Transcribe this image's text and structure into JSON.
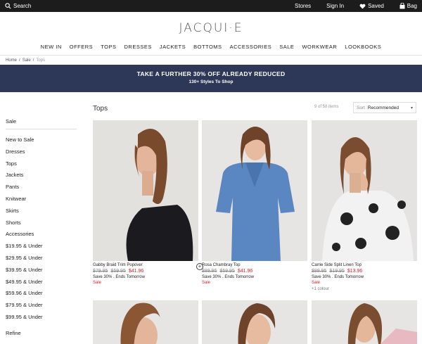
{
  "topbar": {
    "search": "Search",
    "stores": "Stores",
    "sign_in": "Sign In",
    "saved": "Saved",
    "bag": "Bag"
  },
  "logo": "JACQUI·E",
  "nav": [
    "NEW IN",
    "OFFERS",
    "TOPS",
    "DRESSES",
    "JACKETS",
    "BOTTOMS",
    "ACCESSORIES",
    "SALE",
    "WORKWEAR",
    "LOOKBOOKS"
  ],
  "breadcrumb": [
    "Home",
    "Sale",
    "Tops"
  ],
  "banner": {
    "title": "TAKE A FURTHER 30% OFF ALREADY REDUCED",
    "subtitle": "130+ Styles To Shop"
  },
  "sidebar": {
    "heading": "Sale",
    "items": [
      "New to Sale",
      "Dresses",
      "Tops",
      "Jackets",
      "Pants",
      "Knitwear",
      "Skirts",
      "Shorts",
      "Accessories",
      "$19.95 & Under",
      "$29.95 & Under",
      "$39.95 & Under",
      "$49.95 & Under",
      "$59.96 & Under",
      "$79.95 & Under",
      "$99.95 & Under"
    ],
    "refine": "Refine"
  },
  "listing": {
    "title": "Tops",
    "count": "9 of 58 items",
    "sort_label": "Sort",
    "sort_value": "Recommended"
  },
  "products": [
    {
      "name": "Gabby Braid Trim Popover",
      "old1": "$79.95",
      "old2": "$59.95",
      "price": "$41.96",
      "promo": "Save 30% . Ends Tomorrow",
      "sale": "Sale",
      "colours": "",
      "top_color": "#1a1a1f",
      "bg": "#e3e1de"
    },
    {
      "name": "Rosa Chambray Top",
      "old1": "$89.95",
      "old2": "$59.95",
      "price": "$41.96",
      "promo": "Save 30% . Ends Tomorrow",
      "sale": "Sale",
      "colours": "",
      "top_color": "#5a87c2",
      "bg": "#e6e5e3"
    },
    {
      "name": "Carrie Side Split Linen Top",
      "old1": "$89.95",
      "old2": "$19.95",
      "price": "$13.96",
      "promo": "Save 30% . Ends Tomorrow",
      "sale": "Sale",
      "colours": "+1 colour",
      "top_color": "#f2f2f2",
      "bg": "#e4e3e1"
    }
  ],
  "colors": {
    "banner": "#2d3858",
    "sale_red": "#d1222b",
    "topbar": "#1c1c1c"
  }
}
